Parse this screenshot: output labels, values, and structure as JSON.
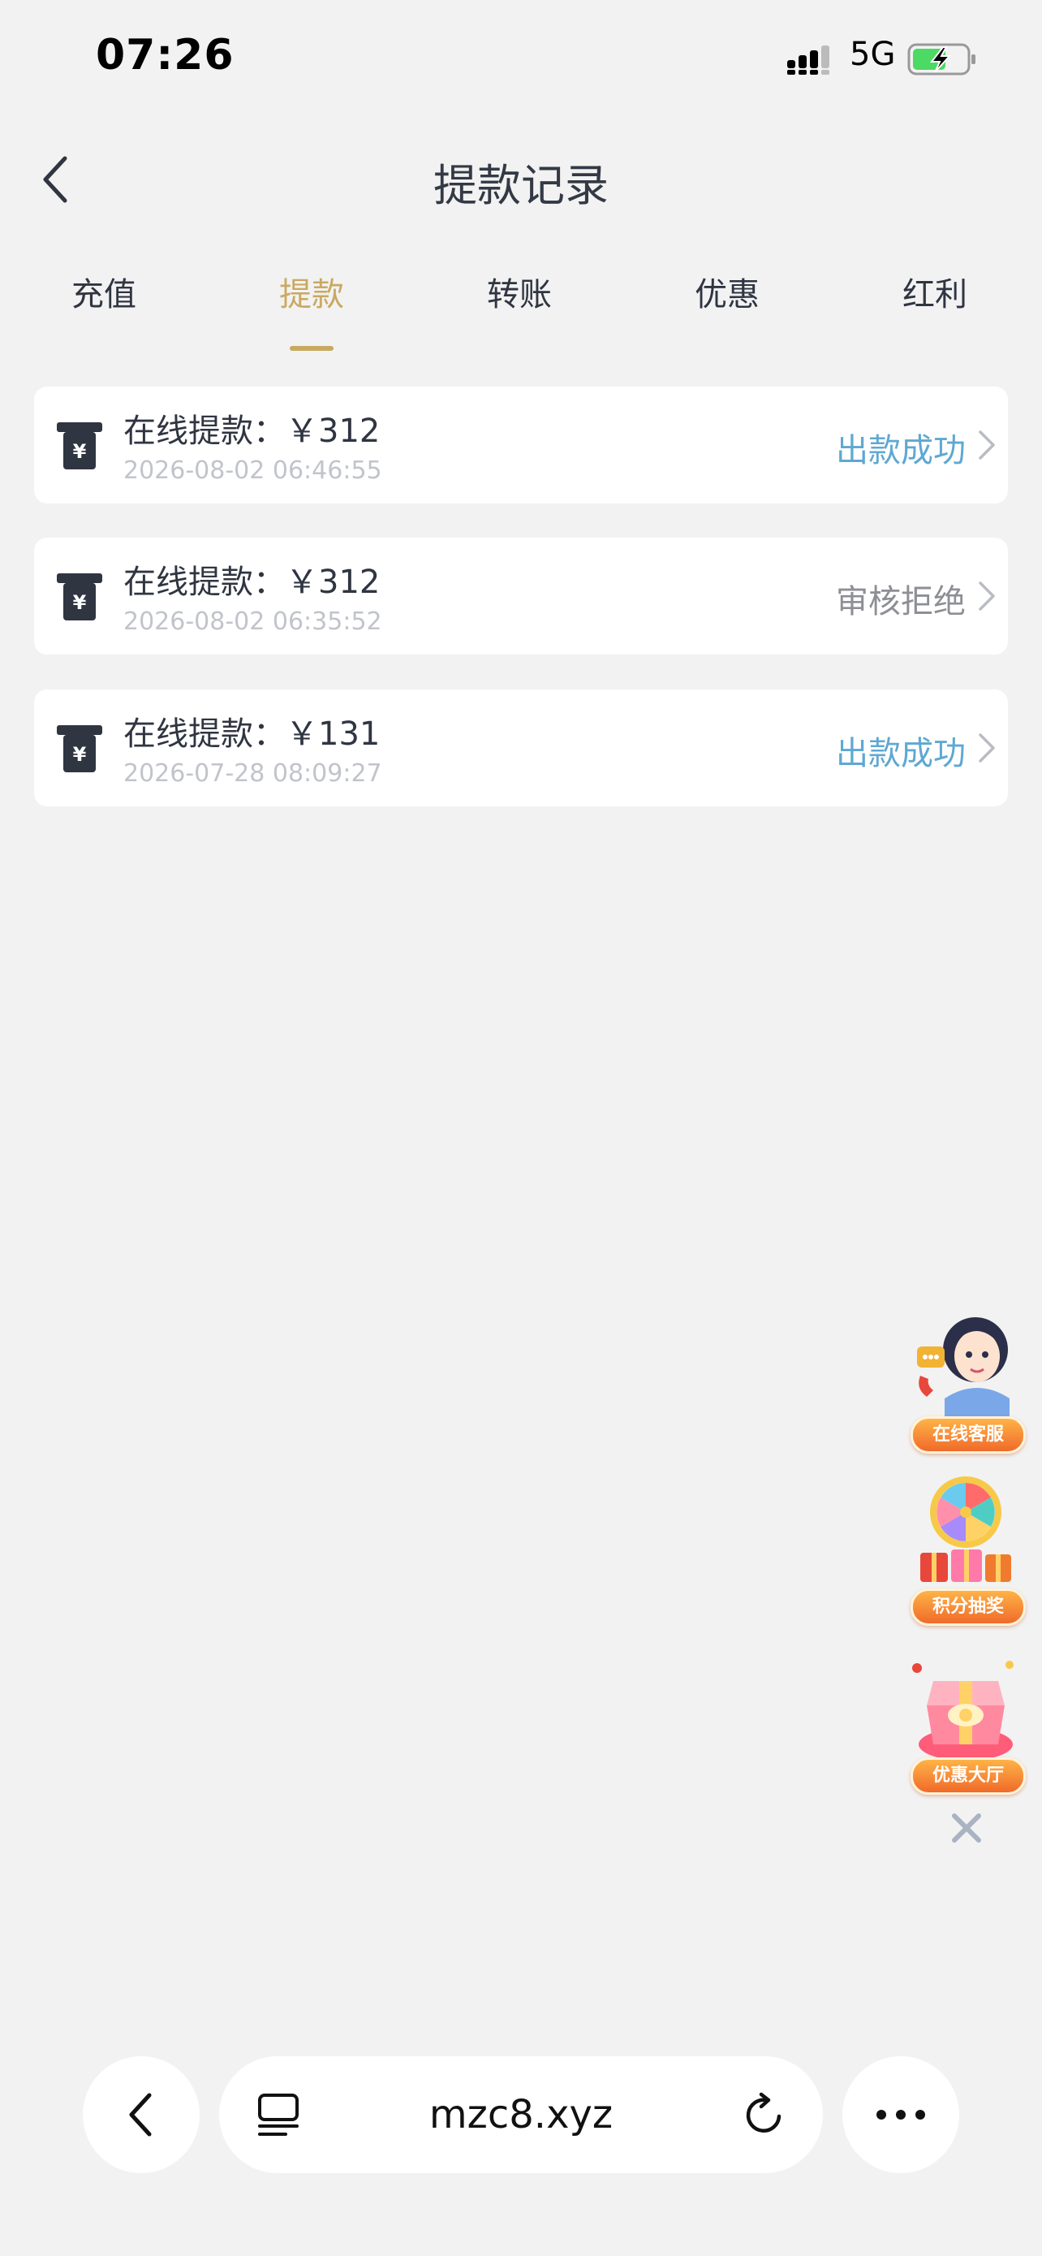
{
  "status_bar": {
    "time": "07:26",
    "network": "5G",
    "battery_color": "#4cd964"
  },
  "header": {
    "title": "提款记录"
  },
  "tabs": [
    {
      "label": "充值",
      "active": false
    },
    {
      "label": "提款",
      "active": true
    },
    {
      "label": "转账",
      "active": false
    },
    {
      "label": "优惠",
      "active": false
    },
    {
      "label": "红利",
      "active": false
    }
  ],
  "records": [
    {
      "title": "在线提款：￥312",
      "time": "2026-08-02 06:46:55",
      "status": "出款成功",
      "status_type": "success"
    },
    {
      "title": "在线提款：￥312",
      "time": "2026-08-02 06:35:52",
      "status": "审核拒绝",
      "status_type": "rejected"
    },
    {
      "title": "在线提款：￥131",
      "time": "2026-07-28 08:09:27",
      "status": "出款成功",
      "status_type": "success"
    }
  ],
  "floating": {
    "service_label": "在线客服",
    "lottery_label": "积分抽奖",
    "promo_label": "优惠大厅"
  },
  "browser_bar": {
    "url": "mzc8.xyz"
  },
  "colors": {
    "accent": "#c9a961",
    "success": "#5fa8d3",
    "rejected": "#8d8f94",
    "background": "#f2f2f2"
  }
}
